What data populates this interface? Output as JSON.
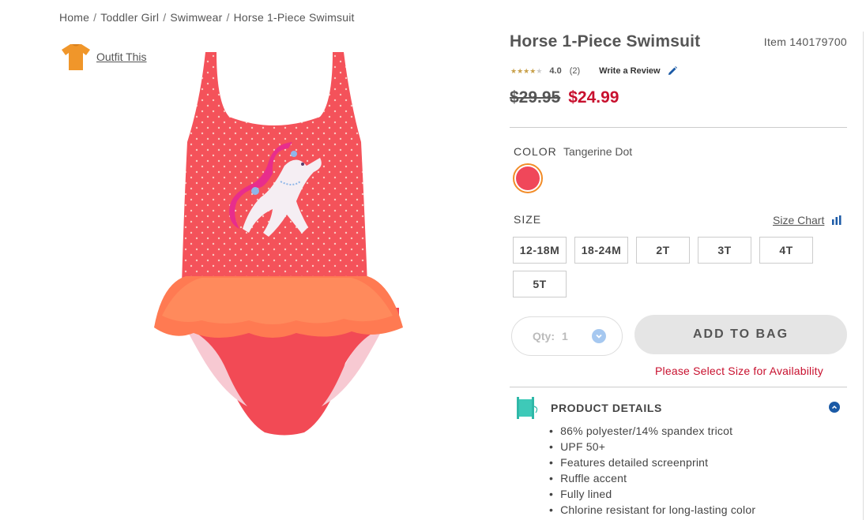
{
  "breadcrumb": [
    "Home",
    "Toddler Girl",
    "Swimwear",
    "Horse 1-Piece Swimsuit"
  ],
  "outfit": {
    "label": "Outfit This",
    "icon": "tshirt-icon"
  },
  "product": {
    "title": "Horse 1-Piece Swimsuit",
    "item_label": "Item",
    "item_number": "140179700",
    "rating": "4.0",
    "rating_stars_filled": 4,
    "review_count": "(2)",
    "write_review": "Write a Review",
    "old_price": "$29.95",
    "new_price": "$24.99"
  },
  "color": {
    "label": "COLOR",
    "value": "Tangerine Dot",
    "swatch_hex": "#f0475a"
  },
  "size": {
    "label": "SIZE",
    "chart_link": "Size Chart",
    "options": [
      "12-18M",
      "18-24M",
      "2T",
      "3T",
      "4T",
      "5T"
    ]
  },
  "qty": {
    "label": "Qty:",
    "value": "1"
  },
  "add_to_bag": "ADD TO BAG",
  "availability_msg": "Please Select Size for Availability",
  "details": {
    "title": "PRODUCT DETAILS",
    "items": [
      "86% polyester/14% spandex tricot",
      "UPF 50+",
      "Features detailed screenprint",
      "Ruffle accent",
      "Fully lined",
      "Chlorine resistant for long-lasting color"
    ]
  },
  "colors": {
    "accent_red": "#c8102e",
    "swatch_ring": "#f28c28",
    "link_blue": "#1b5aa6"
  }
}
